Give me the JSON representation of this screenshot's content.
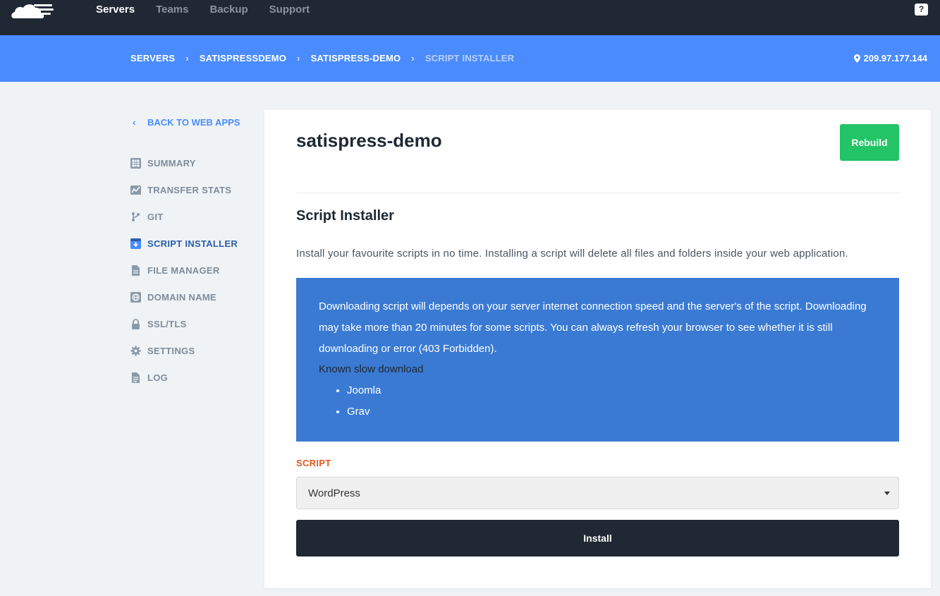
{
  "topnav": {
    "items": [
      "Servers",
      "Teams",
      "Backup",
      "Support"
    ],
    "help_icon": "?"
  },
  "breadcrumb": {
    "items": [
      "SERVERS",
      "SATISPRESSDEMO",
      "SATISPRESS-DEMO",
      "SCRIPT INSTALLER"
    ],
    "ip": "209.97.177.144"
  },
  "sidebar": {
    "back_label": "BACK TO WEB APPS",
    "items": [
      {
        "label": "SUMMARY",
        "icon": "grid-icon"
      },
      {
        "label": "TRANSFER STATS",
        "icon": "chart-icon"
      },
      {
        "label": "GIT",
        "icon": "git-branch-icon"
      },
      {
        "label": "SCRIPT INSTALLER",
        "icon": "download-box-icon"
      },
      {
        "label": "FILE MANAGER",
        "icon": "file-icon"
      },
      {
        "label": "DOMAIN NAME",
        "icon": "globe-icon"
      },
      {
        "label": "SSL/TLS",
        "icon": "lock-icon"
      },
      {
        "label": "SETTINGS",
        "icon": "gear-icon"
      },
      {
        "label": "LOG",
        "icon": "document-icon"
      }
    ],
    "active": "SCRIPT INSTALLER"
  },
  "main": {
    "app_title": "satispress-demo",
    "rebuild_label": "Rebuild",
    "section_title": "Script Installer",
    "description": "Install your favourite scripts in no time. Installing a script will delete all files and folders inside your web application.",
    "info": {
      "message": "Downloading script will depends on your server internet connection speed and the server's of the script. Downloading may take more than 20 minutes for some scripts. You can always refresh your browser to see whether it is still downloading or error (403 Forbidden).",
      "slow_label": "Known slow download",
      "slow_items": [
        "Joomla",
        "Grav"
      ]
    },
    "script_label": "SCRIPT",
    "script_value": "WordPress",
    "install_label": "Install"
  },
  "colors": {
    "topbar": "#1f2833",
    "breadcrumb_bar": "#4a8cff",
    "info_box": "#3a7ad3",
    "rebuild": "#22c466",
    "field_label": "#e05a1c"
  }
}
